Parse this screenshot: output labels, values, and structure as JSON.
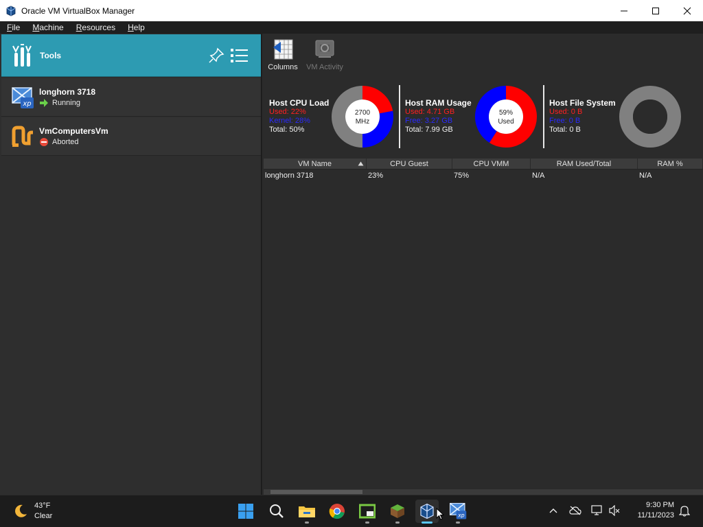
{
  "window": {
    "title": "Oracle VM VirtualBox Manager"
  },
  "menu": [
    "File",
    "Machine",
    "Resources",
    "Help"
  ],
  "sidebar": {
    "tools_label": "Tools",
    "vms": [
      {
        "name": "longhorn 3718",
        "state": "Running",
        "icon": "windows-xp-icon",
        "state_icon": "running-arrow-icon"
      },
      {
        "name": "VmComputersVm",
        "state": "Aborted",
        "icon": "generic-vm-icon",
        "state_icon": "aborted-icon"
      }
    ]
  },
  "toolbar": {
    "columns_label": "Columns",
    "vm_activity_label": "VM Activity"
  },
  "resources": {
    "cpu": {
      "title": "Host CPU Load",
      "line1": "Used: 22%",
      "line2": "Kernel: 28%",
      "total": "Total: 50%",
      "center1": "2700",
      "center2": "MHz",
      "used_fraction": 0.22,
      "kernel_fraction": 0.28
    },
    "ram": {
      "title": "Host RAM Usage",
      "line1": "Used: 4.71 GB",
      "line2": "Free: 3.27 GB",
      "total": "Total: 7.99 GB",
      "center1": "59%",
      "center2": "Used",
      "used_fraction": 0.59
    },
    "fs": {
      "title": "Host File System",
      "line1": "Used: 0 B",
      "line2": "Free: 0 B",
      "total": "Total: 0 B"
    }
  },
  "colors": {
    "used": "#ff0000",
    "free": "#0000ff",
    "empty": "#808080",
    "accent": "#2d9bb2"
  },
  "table": {
    "headers": [
      "VM Name",
      "CPU Guest",
      "CPU VMM",
      "RAM Used/Total",
      "RAM %"
    ],
    "rows": [
      [
        "longhorn 3718",
        "23%",
        "75%",
        "N/A",
        "N/A"
      ]
    ]
  },
  "taskbar": {
    "weather_temp": "43°F",
    "weather_desc": "Clear",
    "time": "9:30 PM",
    "date": "11/11/2023"
  }
}
